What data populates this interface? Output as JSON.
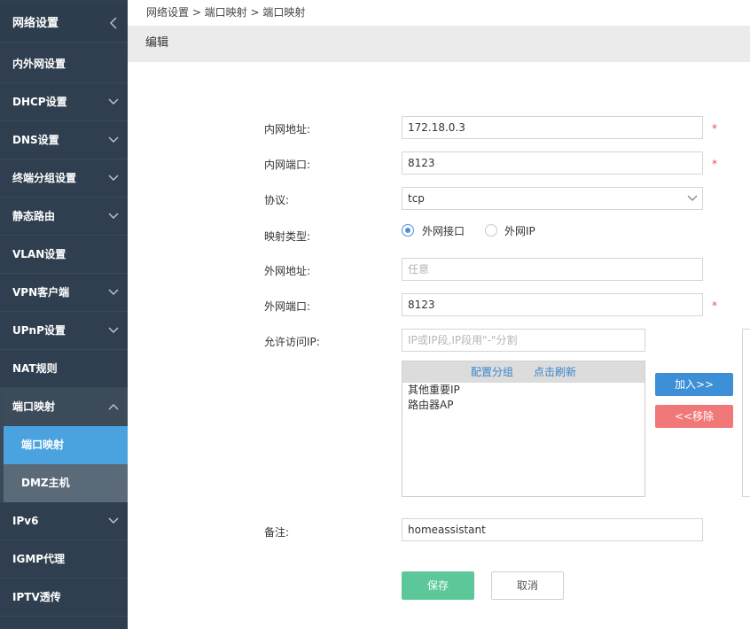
{
  "sidebar": {
    "header": "网络设置",
    "items": [
      {
        "label": "内外网设置"
      },
      {
        "label": "DHCP设置"
      },
      {
        "label": "DNS设置"
      },
      {
        "label": "终端分组设置"
      },
      {
        "label": "静态路由"
      },
      {
        "label": "VLAN设置"
      },
      {
        "label": "VPN客户端"
      },
      {
        "label": "UPnP设置"
      },
      {
        "label": "NAT规则"
      },
      {
        "label": "端口映射"
      },
      {
        "label": "IPv6"
      },
      {
        "label": "IGMP代理"
      },
      {
        "label": "IPTV透传"
      }
    ],
    "subitems": [
      {
        "label": "端口映射"
      },
      {
        "label": "DMZ主机"
      }
    ]
  },
  "breadcrumb": "网络设置 > 端口映射 > 端口映射",
  "edit_title": "编辑",
  "form": {
    "lan_ip_label": "内网地址:",
    "lan_ip_value": "172.18.0.3",
    "lan_port_label": "内网端口:",
    "lan_port_value": "8123",
    "protocol_label": "协议:",
    "protocol_value": "tcp",
    "map_type_label": "映射类型:",
    "map_type_options": [
      "外网接口",
      "外网IP"
    ],
    "map_type_selected": 0,
    "wan_addr_label": "外网地址:",
    "wan_addr_placeholder": "任意",
    "wan_port_label": "外网端口:",
    "wan_port_value": "8123",
    "allow_ip_label": "允许访问IP:",
    "allow_ip_placeholder": "IP或IP段,IP段用\"-\"分割",
    "group_config_link": "配置分组",
    "refresh_link": "点击刷新",
    "groups": [
      "其他重要IP",
      "路由器AP"
    ],
    "add_button": "加入>>",
    "remove_button": "<<移除",
    "remark_label": "备注:",
    "remark_value": "homeassistant",
    "required_mark": "*"
  },
  "buttons": {
    "save": "保存",
    "cancel": "取消"
  },
  "colors": {
    "sidebar_bg": "#2f3f4f",
    "active_blue": "#4aa3df",
    "add_blue": "#3d8fd8",
    "remove_red": "#f07878",
    "save_green": "#5cc89a"
  }
}
